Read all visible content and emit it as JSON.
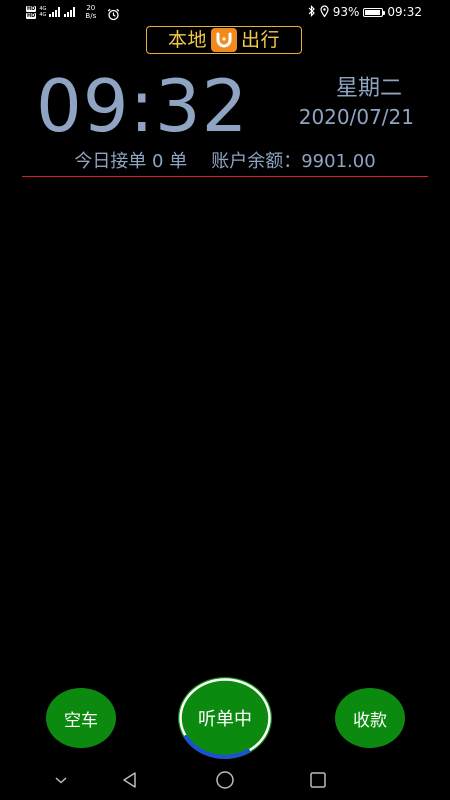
{
  "status_bar": {
    "hd_badge_1": "HD",
    "hd_badge_2": "HD",
    "network_1": "4G",
    "network_2": "4G",
    "speed_value": "20",
    "speed_unit": "B/s",
    "battery_percent": "93%",
    "battery_level": 0.93,
    "time": "09:32"
  },
  "logo": {
    "left_text": "本地",
    "right_text": "出行"
  },
  "clock": {
    "time": "09:32",
    "weekday": "星期二",
    "date": "2020/07/21"
  },
  "summary": {
    "orders_today": "今日接单 0 单",
    "balance": "账户余额：9901.00"
  },
  "buttons": {
    "empty_car": "空车",
    "listening": "听单中",
    "collect_payment": "收款"
  },
  "colors": {
    "accent_text": "#8ea4c2",
    "logo_gold": "#f2c94c",
    "logo_orange": "#f08a1c",
    "button_green": "#0b8a0f",
    "divider_red": "#d4202a",
    "ring_blue": "#1e4fd8"
  },
  "icons": {
    "status_alarm": "alarm-clock-icon",
    "status_bluetooth": "bluetooth-icon",
    "status_location": "location-pin-icon",
    "nav_back": "triangle-back-icon",
    "nav_home": "circle-home-icon",
    "nav_recent": "square-recent-icon",
    "nav_collapse": "chevron-down-icon"
  }
}
